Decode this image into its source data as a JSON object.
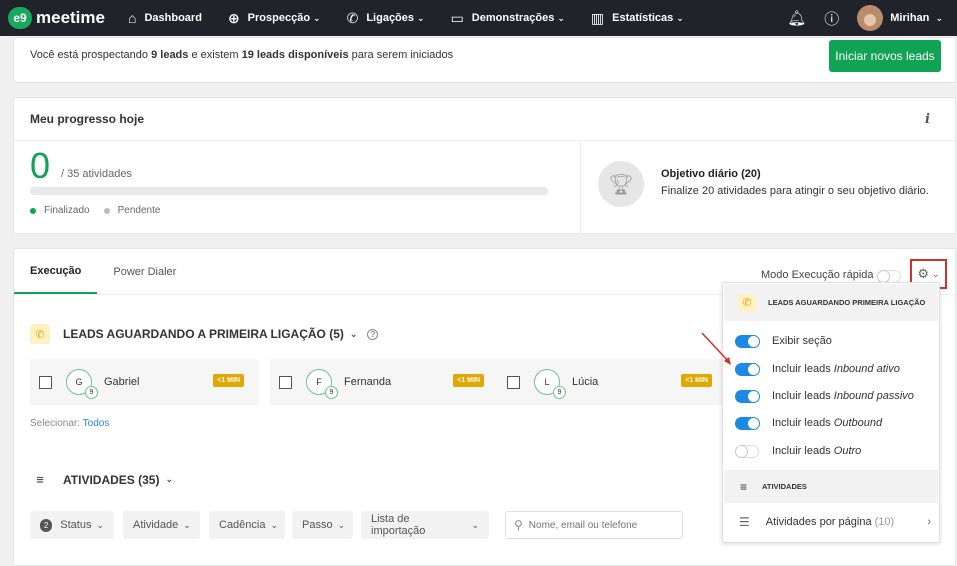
{
  "app": {
    "logo_badge": "e9",
    "logo_text": "meetime"
  },
  "nav": [
    {
      "icon": "home-icon",
      "glyph": "⌂",
      "label": "Dashboard",
      "dropdown": false
    },
    {
      "icon": "target-icon",
      "glyph": "⊕",
      "label": "Prospecção",
      "dropdown": true
    },
    {
      "icon": "phone-icon",
      "glyph": "✆",
      "label": "Ligações",
      "dropdown": true
    },
    {
      "icon": "monitor-icon",
      "glyph": "▭",
      "label": "Demonstrações",
      "dropdown": true
    },
    {
      "icon": "chart-icon",
      "glyph": "▥",
      "label": "Estatísticas",
      "dropdown": true
    }
  ],
  "user": {
    "name": "Mirihan"
  },
  "banner": {
    "t1": "Você está prospectando ",
    "leads_prospecting": "9 leads",
    "t2": " e existem ",
    "leads_available": "19 leads disponíveis",
    "t3": " para serem iniciados",
    "button": "Iniciar novos leads"
  },
  "progress": {
    "title": "Meu progresso hoje",
    "info": "i",
    "done": "0",
    "of_label": "/ 35 atividades",
    "progress_fraction": 0,
    "legend_done": "Finalizado",
    "legend_pending": "Pendente",
    "goal_title": "Objetivo diário (20)",
    "goal_desc": "Finalize 20 atividades para atingir o seu objetivo diário."
  },
  "tabs": [
    {
      "label": "Execução",
      "active": true
    },
    {
      "label": "Power Dialer",
      "active": false
    }
  ],
  "quick_mode": {
    "label": "Modo Execução rápida",
    "on": false
  },
  "section_leads": {
    "title": "LEADS AGUARDANDO A PRIMEIRA LIGAÇÃO (5)",
    "leads": [
      {
        "initial": "G",
        "badge": "9",
        "name": "Gabriel",
        "time": "<1 MIN"
      },
      {
        "initial": "F",
        "badge": "9",
        "name": "Fernanda",
        "time": "<1 MIN"
      },
      {
        "initial": "L",
        "badge": "9",
        "name": "Lúcia",
        "time": "<1 MIN"
      }
    ],
    "select_label": "Selecionar: ",
    "select_all": "Todos"
  },
  "section_activities": {
    "title": "ATIVIDADES (35)",
    "filters": [
      {
        "label": "Status",
        "badge": "2"
      },
      {
        "label": "Atividade"
      },
      {
        "label": "Cadência"
      },
      {
        "label": "Passo"
      },
      {
        "label": "Lista de importação"
      }
    ],
    "search_placeholder": "Nome, email ou telefone"
  },
  "settings_dropdown": {
    "header": "LEADS AGUARDANDO PRIMEIRA LIGAÇÃO",
    "options": [
      {
        "prefix": "Exibir seção",
        "em": "",
        "on": true
      },
      {
        "prefix": "Incluir leads ",
        "em": "Inbound ativo",
        "on": true
      },
      {
        "prefix": "Incluir leads ",
        "em": "Inbound passivo",
        "on": true
      },
      {
        "prefix": "Incluir leads ",
        "em": "Outbound",
        "on": true
      },
      {
        "prefix": "Incluir leads ",
        "em": "Outro",
        "on": false
      }
    ],
    "activities_header": "ATIVIDADES",
    "per_page_label": "Atividades por página",
    "per_page_value": "(10)"
  },
  "colors": {
    "brand_green": "#10a354",
    "toggle_blue": "#1e88e5",
    "badge_yellow": "#e0a800",
    "highlight_red": "#d32f2f"
  }
}
